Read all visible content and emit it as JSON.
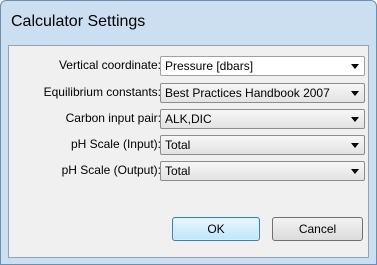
{
  "window": {
    "title": "Calculator Settings"
  },
  "fields": [
    {
      "label": "Vertical coordinate:",
      "value": "Pressure [dbars]"
    },
    {
      "label": "Equilibrium constants:",
      "value": "Best Practices Handbook 2007"
    },
    {
      "label": "Carbon input pair:",
      "value": "ALK,DIC"
    },
    {
      "label": "pH Scale (Input):",
      "value": "Total"
    },
    {
      "label": "pH Scale (Output):",
      "value": "Total"
    }
  ],
  "buttons": {
    "ok_label": "OK",
    "cancel_label": "Cancel"
  },
  "icons": {
    "dropdown": "chevron-down-icon"
  },
  "colors": {
    "title_bar": "#cbdff1",
    "client_bg": "#f0f0f0",
    "ok_border": "#3c7fb1"
  }
}
